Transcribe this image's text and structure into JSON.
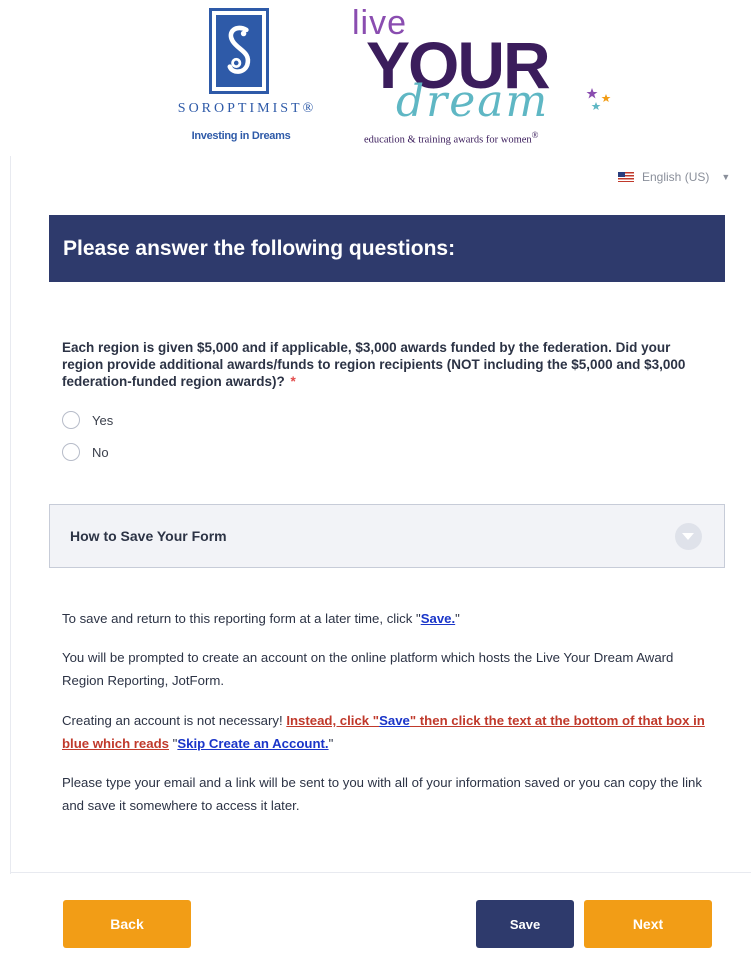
{
  "logos": {
    "soroptimist": {
      "wordmark": "SOROPTIMIST®",
      "tagline": "Investing in Dreams",
      "icon": "s-crest-icon"
    },
    "live_your_dream": {
      "live": "live",
      "your": "YOUR",
      "dream": "dream",
      "tagline": "education & training awards for women",
      "reg_mark": "®"
    }
  },
  "language": {
    "label": "English (US)",
    "flag_icon": "us-flag-icon"
  },
  "header": {
    "title": "Please answer the following questions:"
  },
  "question": {
    "text": "Each region is given $5,000 and if applicable, $3,000 awards funded by the federation. Did your region provide additional awards/funds to region recipients (NOT including the $5,000 and $3,000 federation-funded region awards)?",
    "required_mark": "*",
    "options": [
      "Yes",
      "No"
    ]
  },
  "collapse": {
    "title": "How to Save Your Form",
    "icon": "chevron-down-icon"
  },
  "instructions": {
    "p1_pre": "To save and return to this reporting form at a later time, click \"",
    "p1_link": "Save.",
    "p1_post": "\"",
    "p2": "You will be prompted to create an account on the online platform which hosts the Live Your Dream Award Region Reporting, JotForm.",
    "p3_pre": "Creating an account is not necessary! ",
    "p3_red1": "Instead, click \"",
    "p3_link1": "Save",
    "p3_red2": "\" then click the text at the bottom of that box in blue which reads",
    "p3_mid": " \"",
    "p3_link2": "Skip Create an Account.",
    "p3_post": "\"",
    "p4": "Please type your email and a link will be sent to you with all of your information saved or you can copy the link and save it somewhere to access it later."
  },
  "buttons": {
    "back": "Back",
    "save": "Save",
    "next": "Next"
  },
  "colors": {
    "header_bg": "#2e3a6c",
    "accent_orange": "#f29d16",
    "link_blue": "#1a35c9",
    "required_red": "#e24a4a",
    "note_red": "#c0392b"
  }
}
